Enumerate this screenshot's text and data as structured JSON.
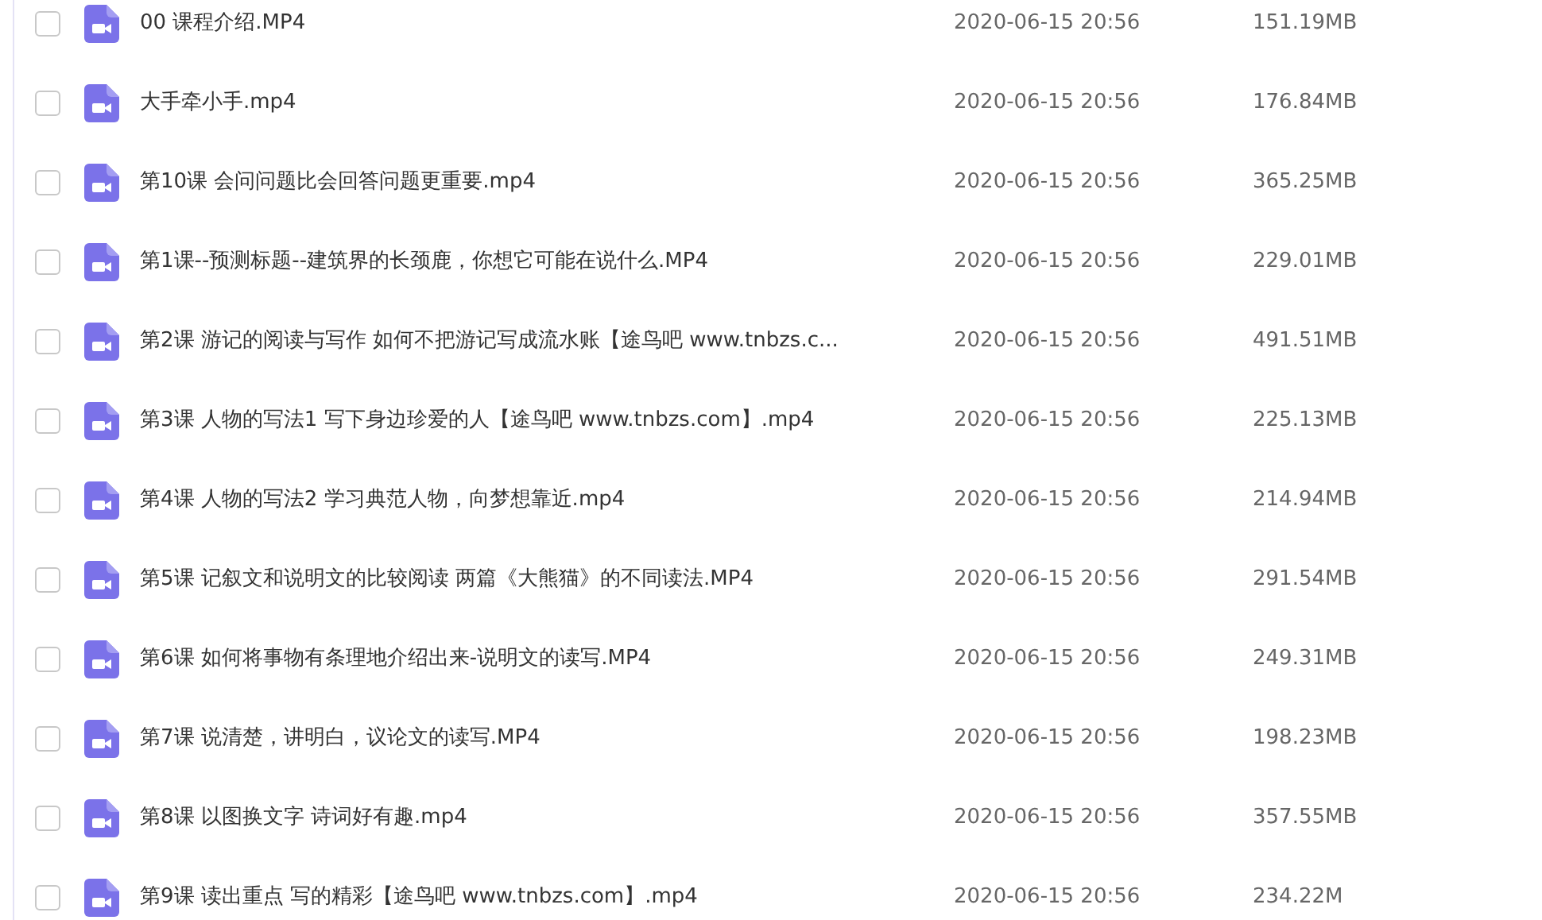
{
  "files": [
    {
      "name": "00 课程介绍.MP4",
      "modified": "2020-06-15 20:56",
      "size": "151.19MB",
      "checked": false
    },
    {
      "name": "大手牵小手.mp4",
      "modified": "2020-06-15 20:56",
      "size": "176.84MB",
      "checked": false
    },
    {
      "name": "第10课 会问问题比会回答问题更重要.mp4",
      "modified": "2020-06-15 20:56",
      "size": "365.25MB",
      "checked": false
    },
    {
      "name": "第1课--预测标题--建筑界的长颈鹿，你想它可能在说什么.MP4",
      "modified": "2020-06-15 20:56",
      "size": "229.01MB",
      "checked": false
    },
    {
      "name": "第2课 游记的阅读与写作 如何不把游记写成流水账【途鸟吧 www.tnbzs.c...",
      "modified": "2020-06-15 20:56",
      "size": "491.51MB",
      "checked": false
    },
    {
      "name": "第3课 人物的写法1 写下身边珍爱的人【途鸟吧 www.tnbzs.com】.mp4",
      "modified": "2020-06-15 20:56",
      "size": "225.13MB",
      "checked": false
    },
    {
      "name": "第4课 人物的写法2 学习典范人物，向梦想靠近.mp4",
      "modified": "2020-06-15 20:56",
      "size": "214.94MB",
      "checked": false
    },
    {
      "name": "第5课 记叙文和说明文的比较阅读 两篇《大熊猫》的不同读法.MP4",
      "modified": "2020-06-15 20:56",
      "size": "291.54MB",
      "checked": false
    },
    {
      "name": "第6课 如何将事物有条理地介绍出来-说明文的读写.MP4",
      "modified": "2020-06-15 20:56",
      "size": "249.31MB",
      "checked": false
    },
    {
      "name": "第7课 说清楚，讲明白，议论文的读写.MP4",
      "modified": "2020-06-15 20:56",
      "size": "198.23MB",
      "checked": false
    },
    {
      "name": "第8课 以图换文字 诗词好有趣.mp4",
      "modified": "2020-06-15 20:56",
      "size": "357.55MB",
      "checked": false
    },
    {
      "name": "第9课  读出重点 写的精彩【途鸟吧 www.tnbzs.com】.mp4",
      "modified": "2020-06-15 20:56",
      "size": "234.22M",
      "checked": false
    }
  ]
}
